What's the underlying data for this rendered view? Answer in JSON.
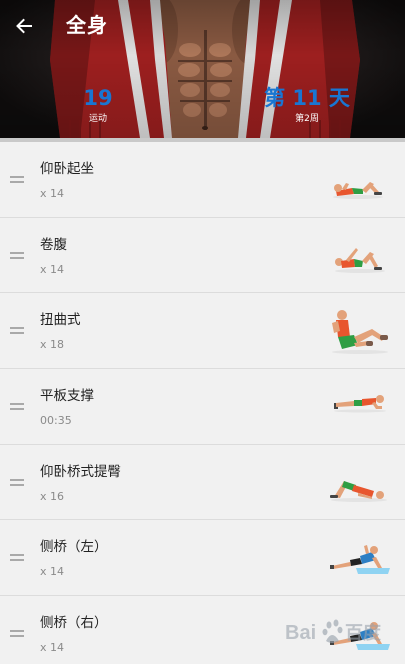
{
  "header": {
    "title": "全身",
    "back_icon": "arrow-left-icon",
    "stats": [
      {
        "value": "19",
        "label": "运动"
      },
      {
        "value": "第 11 天",
        "label": "第2周"
      }
    ],
    "accent_color": "#1976d2"
  },
  "exercises": [
    {
      "name": "仰卧起坐",
      "detail": "x 14",
      "thumbnail": "sit-up-figure"
    },
    {
      "name": "卷腹",
      "detail": "x 14",
      "thumbnail": "crunch-figure"
    },
    {
      "name": "扭曲式",
      "detail": "x 18",
      "thumbnail": "twist-figure"
    },
    {
      "name": "平板支撑",
      "detail": "00:35",
      "thumbnail": "plank-figure"
    },
    {
      "name": "仰卧桥式提臀",
      "detail": "x 16",
      "thumbnail": "glute-bridge-figure"
    },
    {
      "name": "侧桥（左）",
      "detail": "x 14",
      "thumbnail": "side-bridge-left-figure"
    },
    {
      "name": "侧桥（右）",
      "detail": "x 14",
      "thumbnail": "side-bridge-right-figure"
    }
  ],
  "watermark": {
    "text": "Bai百度"
  }
}
